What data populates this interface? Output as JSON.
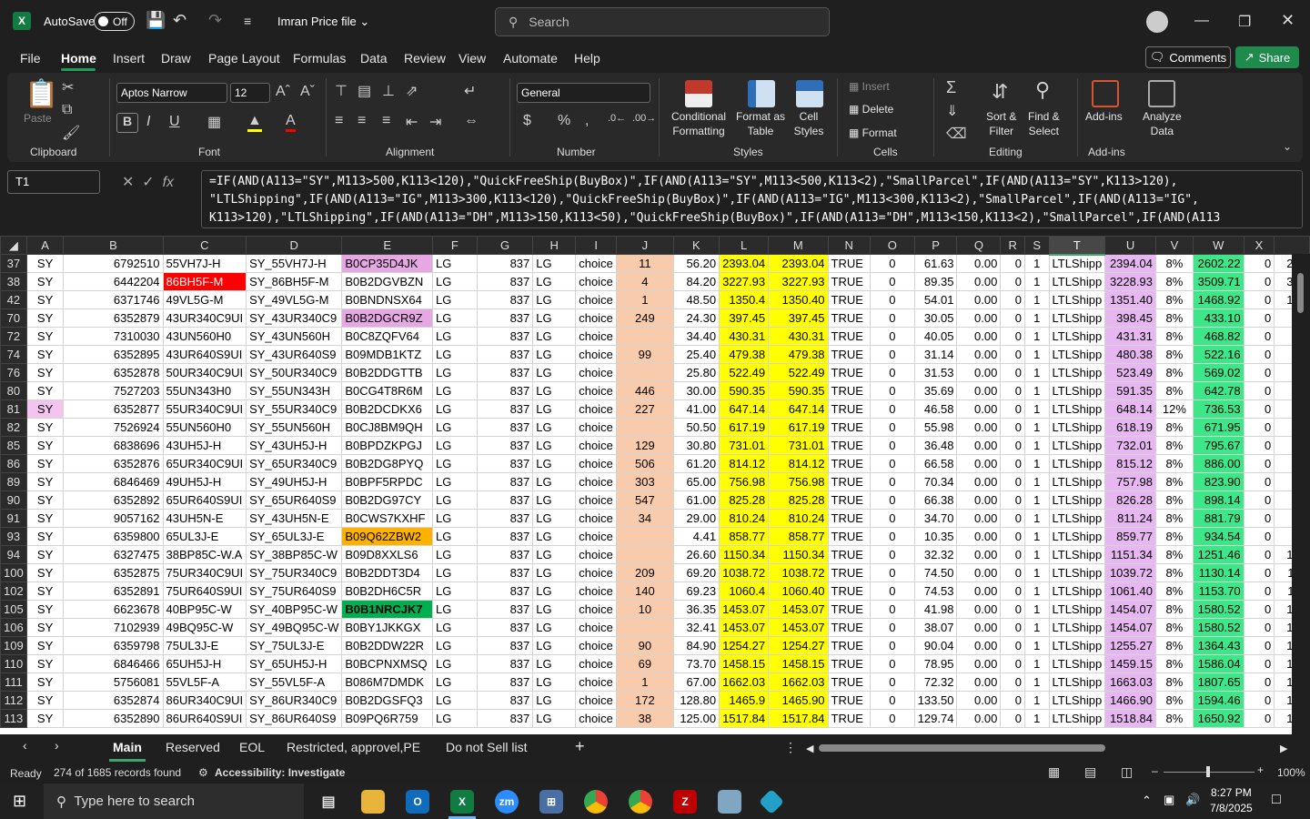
{
  "title_bar": {
    "autosave_label": "AutoSave",
    "autosave_state": "Off",
    "filename": "Imran Price file",
    "search_placeholder": "Search"
  },
  "menu": {
    "items": [
      "File",
      "Home",
      "Insert",
      "Draw",
      "Page Layout",
      "Formulas",
      "Data",
      "Review",
      "View",
      "Automate",
      "Help"
    ],
    "comments": "Comments",
    "share": "Share"
  },
  "ribbon": {
    "clipboard": {
      "paste": "Paste",
      "label": "Clipboard"
    },
    "font": {
      "name": "Aptos Narrow",
      "size": "12",
      "label": "Font"
    },
    "alignment": {
      "label": "Alignment"
    },
    "number": {
      "format": "General",
      "label": "Number"
    },
    "styles": {
      "conditional": "Conditional\nFormatting",
      "format_table": "Format as\nTable",
      "cell_styles": "Cell\nStyles",
      "label": "Styles"
    },
    "cells": {
      "insert": "Insert",
      "delete": "Delete",
      "format": "Format",
      "label": "Cells"
    },
    "editing": {
      "sort": "Sort &\nFilter",
      "find": "Find &\nSelect",
      "label": "Editing"
    },
    "addins": {
      "addins": "Add-ins",
      "analyze": "Analyze\nData",
      "label": "Add-ins"
    }
  },
  "formula_bar": {
    "name_box": "T1",
    "fx": "fx",
    "formula": "=IF(AND(A113=\"SY\",M113>500,K113<120),\"QuickFreeShip(BuyBox)\",IF(AND(A113=\"SY\",M113<500,K113<2),\"SmallParcel\",IF(AND(A113=\"SY\",K113>120),\n\"LTLShipping\",IF(AND(A113=\"IG\",M113>300,K113<120),\"QuickFreeShip(BuyBox)\",IF(AND(A113=\"IG\",M113<300,K113<2),\"SmallParcel\",IF(AND(A113=\"IG\",\nK113>120),\"LTLShipping\",IF(AND(A113=\"DH\",M113>150,K113<50),\"QuickFreeShip(BuyBox)\",IF(AND(A113=\"DH\",M113<150,K113<2),\"SmallParcel\",IF(AND(A113"
  },
  "columns": [
    "A",
    "B",
    "C",
    "D",
    "E",
    "F",
    "G",
    "H",
    "I",
    "J",
    "K",
    "L",
    "M",
    "N",
    "O",
    "P",
    "Q",
    "R",
    "S",
    "T",
    "U",
    "V",
    "W",
    "X",
    ""
  ],
  "rows": [
    [
      "37",
      "SY",
      "6792510",
      "55VH7J-H",
      "SY_55VH7J-H",
      "B0CP35D4JK",
      "LG",
      "837",
      "LG",
      "choice",
      "11",
      "56.20",
      "2393.04",
      "2393.04",
      "TRUE",
      "0",
      "61.63",
      "0.00",
      "0",
      "1",
      "LTLShipp",
      "2394.04",
      "8%",
      "2602.22",
      "0",
      "260"
    ],
    [
      "38",
      "SY",
      "6442204",
      "86BH5F-M",
      "SY_86BH5F-M",
      "B0B2DGVBZN",
      "LG",
      "837",
      "LG",
      "choice",
      "4",
      "84.20",
      "3227.93",
      "3227.93",
      "TRUE",
      "0",
      "89.35",
      "0.00",
      "0",
      "1",
      "LTLShipp",
      "3228.93",
      "8%",
      "3509.71",
      "0",
      "351"
    ],
    [
      "42",
      "SY",
      "6371746",
      "49VL5G-M",
      "SY_49VL5G-M",
      "B0BNDNSX64",
      "LG",
      "837",
      "LG",
      "choice",
      "1",
      "48.50",
      "1350.4",
      "1350.40",
      "TRUE",
      "0",
      "54.01",
      "0.00",
      "0",
      "1",
      "LTLShipp",
      "1351.40",
      "8%",
      "1468.92",
      "0",
      "147"
    ],
    [
      "70",
      "SY",
      "6352879",
      "43UR340C9UI",
      "SY_43UR340C9",
      "B0B2DGCR9Z",
      "LG",
      "837",
      "LG",
      "choice",
      "249",
      "24.30",
      "397.45",
      "397.45",
      "TRUE",
      "0",
      "30.05",
      "0.00",
      "0",
      "1",
      "LTLShipp",
      "398.45",
      "8%",
      "433.10",
      "0",
      "44"
    ],
    [
      "72",
      "SY",
      "7310030",
      "43UN560H0",
      "SY_43UN560H",
      "B0C8ZQFV64",
      "LG",
      "837",
      "LG",
      "choice",
      "",
      "34.40",
      "430.31",
      "430.31",
      "TRUE",
      "0",
      "40.05",
      "0.00",
      "0",
      "1",
      "LTLShipp",
      "431.31",
      "8%",
      "468.82",
      "0",
      "47"
    ],
    [
      "74",
      "SY",
      "6352895",
      "43UR640S9UI",
      "SY_43UR640S9",
      "B09MDB1KTZ",
      "LG",
      "837",
      "LG",
      "choice",
      "99",
      "25.40",
      "479.38",
      "479.38",
      "TRUE",
      "0",
      "31.14",
      "0.00",
      "0",
      "1",
      "LTLShipp",
      "480.38",
      "8%",
      "522.16",
      "0",
      "52"
    ],
    [
      "76",
      "SY",
      "6352878",
      "50UR340C9UI",
      "SY_50UR340C9",
      "B0B2DDGTTB",
      "LG",
      "837",
      "LG",
      "choice",
      "",
      "25.80",
      "522.49",
      "522.49",
      "TRUE",
      "0",
      "31.53",
      "0.00",
      "0",
      "1",
      "LTLShipp",
      "523.49",
      "8%",
      "569.02",
      "0",
      "57"
    ],
    [
      "80",
      "SY",
      "7527203",
      "55UN343H0",
      "SY_55UN343H",
      "B0CG4T8R6M",
      "LG",
      "837",
      "LG",
      "choice",
      "446",
      "30.00",
      "590.35",
      "590.35",
      "TRUE",
      "0",
      "35.69",
      "0.00",
      "0",
      "1",
      "LTLShipp",
      "591.35",
      "8%",
      "642.78",
      "0",
      "64"
    ],
    [
      "81",
      "SY",
      "6352877",
      "55UR340C9UI",
      "SY_55UR340C9",
      "B0B2DCDKX6",
      "LG",
      "837",
      "LG",
      "choice",
      "227",
      "41.00",
      "647.14",
      "647.14",
      "TRUE",
      "0",
      "46.58",
      "0.00",
      "0",
      "1",
      "LTLShipp",
      "648.14",
      "12%",
      "736.53",
      "0",
      "74"
    ],
    [
      "82",
      "SY",
      "7526924",
      "55UN560H0",
      "SY_55UN560H",
      "B0CJ8BM9QH",
      "LG",
      "837",
      "LG",
      "choice",
      "",
      "50.50",
      "617.19",
      "617.19",
      "TRUE",
      "0",
      "55.98",
      "0.00",
      "0",
      "1",
      "LTLShipp",
      "618.19",
      "8%",
      "671.95",
      "0",
      "67"
    ],
    [
      "85",
      "SY",
      "6838696",
      "43UH5J-H",
      "SY_43UH5J-H",
      "B0BPDZKPGJ",
      "LG",
      "837",
      "LG",
      "choice",
      "129",
      "30.80",
      "731.01",
      "731.01",
      "TRUE",
      "0",
      "36.48",
      "0.00",
      "0",
      "1",
      "LTLShipp",
      "732.01",
      "8%",
      "795.67",
      "0",
      "80"
    ],
    [
      "86",
      "SY",
      "6352876",
      "65UR340C9UI",
      "SY_65UR340C9",
      "B0B2DG8PYQ",
      "LG",
      "837",
      "LG",
      "choice",
      "506",
      "61.20",
      "814.12",
      "814.12",
      "TRUE",
      "0",
      "66.58",
      "0.00",
      "0",
      "1",
      "LTLShipp",
      "815.12",
      "8%",
      "886.00",
      "0",
      "89"
    ],
    [
      "89",
      "SY",
      "6846469",
      "49UH5J-H",
      "SY_49UH5J-H",
      "B0BPF5RPDC",
      "LG",
      "837",
      "LG",
      "choice",
      "303",
      "65.00",
      "756.98",
      "756.98",
      "TRUE",
      "0",
      "70.34",
      "0.00",
      "0",
      "1",
      "LTLShipp",
      "757.98",
      "8%",
      "823.90",
      "0",
      "82"
    ],
    [
      "90",
      "SY",
      "6352892",
      "65UR640S9UI",
      "SY_65UR640S9",
      "B0B2DG97CY",
      "LG",
      "837",
      "LG",
      "choice",
      "547",
      "61.00",
      "825.28",
      "825.28",
      "TRUE",
      "0",
      "66.38",
      "0.00",
      "0",
      "1",
      "LTLShipp",
      "826.28",
      "8%",
      "898.14",
      "0",
      "90"
    ],
    [
      "91",
      "SY",
      "9057162",
      "43UH5N-E",
      "SY_43UH5N-E",
      "B0CWS7KXHF",
      "LG",
      "837",
      "LG",
      "choice",
      "34",
      "29.00",
      "810.24",
      "810.24",
      "TRUE",
      "0",
      "34.70",
      "0.00",
      "0",
      "1",
      "LTLShipp",
      "811.24",
      "8%",
      "881.79",
      "0",
      "88"
    ],
    [
      "93",
      "SY",
      "6359800",
      "65UL3J-E",
      "SY_65UL3J-E",
      "B09Q62ZBW2",
      "LG",
      "837",
      "LG",
      "choice",
      "",
      "4.41",
      "858.77",
      "858.77",
      "TRUE",
      "0",
      "10.35",
      "0.00",
      "0",
      "1",
      "LTLShipp",
      "859.77",
      "8%",
      "934.54",
      "0",
      "94"
    ],
    [
      "94",
      "SY",
      "6327475",
      "38BP85C-W.A",
      "SY_38BP85C-W",
      "B09D8XXLS6",
      "LG",
      "837",
      "LG",
      "choice",
      "",
      "26.60",
      "1150.34",
      "1150.34",
      "TRUE",
      "0",
      "32.32",
      "0.00",
      "0",
      "1",
      "LTLShipp",
      "1151.34",
      "8%",
      "1251.46",
      "0",
      "125"
    ],
    [
      "100",
      "SY",
      "6352875",
      "75UR340C9UI",
      "SY_75UR340C9",
      "B0B2DDT3D4",
      "LG",
      "837",
      "LG",
      "choice",
      "209",
      "69.20",
      "1038.72",
      "1038.72",
      "TRUE",
      "0",
      "74.50",
      "0.00",
      "0",
      "1",
      "LTLShipp",
      "1039.72",
      "8%",
      "1130.14",
      "0",
      "113"
    ],
    [
      "102",
      "SY",
      "6352891",
      "75UR640S9UI",
      "SY_75UR640S9",
      "B0B2DH6C5R",
      "LG",
      "837",
      "LG",
      "choice",
      "140",
      "69.23",
      "1060.4",
      "1060.40",
      "TRUE",
      "0",
      "74.53",
      "0.00",
      "0",
      "1",
      "LTLShipp",
      "1061.40",
      "8%",
      "1153.70",
      "0",
      "115"
    ],
    [
      "105",
      "SY",
      "6623678",
      "40BP95C-W",
      "SY_40BP95C-W",
      "B0B1NRCJK7",
      "LG",
      "837",
      "LG",
      "choice",
      "10",
      "36.35",
      "1453.07",
      "1453.07",
      "TRUE",
      "0",
      "41.98",
      "0.00",
      "0",
      "1",
      "LTLShipp",
      "1454.07",
      "8%",
      "1580.52",
      "0",
      "158"
    ],
    [
      "106",
      "SY",
      "7102939",
      "49BQ95C-W",
      "SY_49BQ95C-W",
      "B0BY1JKKGX",
      "LG",
      "837",
      "LG",
      "choice",
      "",
      "32.41",
      "1453.07",
      "1453.07",
      "TRUE",
      "0",
      "38.07",
      "0.00",
      "0",
      "1",
      "LTLShipp",
      "1454.07",
      "8%",
      "1580.52",
      "0",
      "158"
    ],
    [
      "109",
      "SY",
      "6359798",
      "75UL3J-E",
      "SY_75UL3J-E",
      "B0B2DDW22R",
      "LG",
      "837",
      "LG",
      "choice",
      "90",
      "84.90",
      "1254.27",
      "1254.27",
      "TRUE",
      "0",
      "90.04",
      "0.00",
      "0",
      "1",
      "LTLShipp",
      "1255.27",
      "8%",
      "1364.43",
      "0",
      "137"
    ],
    [
      "110",
      "SY",
      "6846466",
      "65UH5J-H",
      "SY_65UH5J-H",
      "B0BCPNXMSQ",
      "LG",
      "837",
      "LG",
      "choice",
      "69",
      "73.70",
      "1458.15",
      "1458.15",
      "TRUE",
      "0",
      "78.95",
      "0.00",
      "0",
      "1",
      "LTLShipp",
      "1459.15",
      "8%",
      "1586.04",
      "0",
      "159"
    ],
    [
      "111",
      "SY",
      "5756081",
      "55VL5F-A",
      "SY_55VL5F-A",
      "B086M7DMDK",
      "LG",
      "837",
      "LG",
      "choice",
      "1",
      "67.00",
      "1662.03",
      "1662.03",
      "TRUE",
      "0",
      "72.32",
      "0.00",
      "0",
      "1",
      "LTLShipp",
      "1663.03",
      "8%",
      "1807.65",
      "0",
      "181"
    ],
    [
      "112",
      "SY",
      "6352874",
      "86UR340C9UI",
      "SY_86UR340C9",
      "B0B2DGSFQ3",
      "LG",
      "837",
      "LG",
      "choice",
      "172",
      "128.80",
      "1465.9",
      "1465.90",
      "TRUE",
      "0",
      "133.50",
      "0.00",
      "0",
      "1",
      "LTLShipp",
      "1466.90",
      "8%",
      "1594.46",
      "0",
      "160"
    ],
    [
      "113",
      "SY",
      "6352890",
      "86UR640S9UI",
      "SY_86UR640S9",
      "B09PQ6R759",
      "LG",
      "837",
      "LG",
      "choice",
      "38",
      "125.00",
      "1517.84",
      "1517.84",
      "TRUE",
      "0",
      "129.74",
      "0.00",
      "0",
      "1",
      "LTLShipp",
      "1518.84",
      "8%",
      "1650.92",
      "0",
      "165"
    ]
  ],
  "sheet_tabs": [
    "Main",
    "Reserved",
    "EOL",
    "Restricted, approvel,PE",
    "Do not Sell list"
  ],
  "status": {
    "mode": "Ready",
    "records": "274 of 1685 records found",
    "accessibility": "Accessibility: Investigate",
    "zoom": "100%"
  },
  "taskbar": {
    "search_placeholder": "Type here to search",
    "time": "8:27 PM",
    "date": "7/8/2025"
  }
}
